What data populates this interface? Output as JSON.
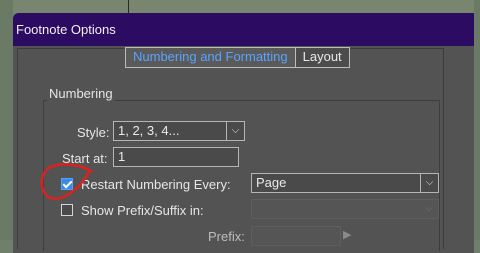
{
  "window": {
    "title": "Footnote Options"
  },
  "tabs": [
    {
      "label": "Numbering and Formatting",
      "active": true
    },
    {
      "label": "Layout",
      "active": false
    }
  ],
  "numbering": {
    "group_label": "Numbering",
    "style": {
      "label": "Style:",
      "value": "1, 2, 3, 4..."
    },
    "start_at": {
      "label": "Start at:",
      "value": "1"
    },
    "restart": {
      "label": "Restart Numbering Every:",
      "checked": true,
      "value": "Page"
    },
    "prefix_suffix": {
      "label": "Show Prefix/Suffix in:",
      "checked": false,
      "value": ""
    },
    "prefix": {
      "label": "Prefix:"
    }
  },
  "colors": {
    "titlebar": "#2c0b63",
    "dialog_bg": "#535353",
    "active_tab_text": "#5aa3ff",
    "checkbox_checked": "#3b8ae8",
    "annotation_red": "#e0201c"
  }
}
